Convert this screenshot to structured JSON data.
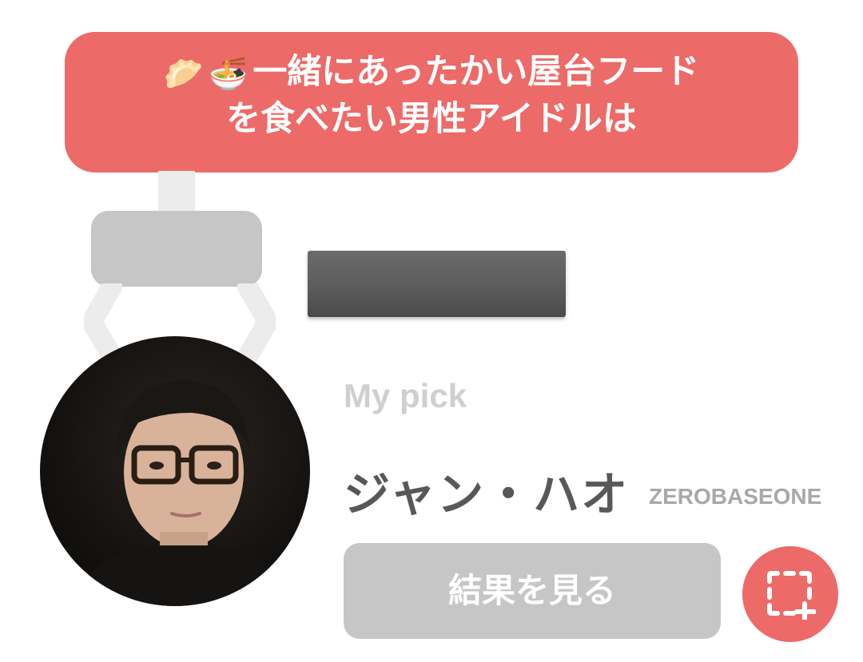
{
  "question": {
    "emojis": [
      "🥟",
      "🍜"
    ],
    "line1": "一緒にあったかい屋台フード",
    "line2": "を食べたい男性アイドルは"
  },
  "result": {
    "my_pick_label": "My pick",
    "idol_name": "ジャン・ハオ",
    "group_name": "ZEROBASEONE",
    "view_results_label": "結果を見る"
  },
  "icons": {
    "capture": "screenshot-capture-icon"
  },
  "colors": {
    "accent": "#ec6a68",
    "button_gray": "#c6c6c6",
    "name_text": "#585858",
    "label_gray": "#cfcfcf"
  }
}
